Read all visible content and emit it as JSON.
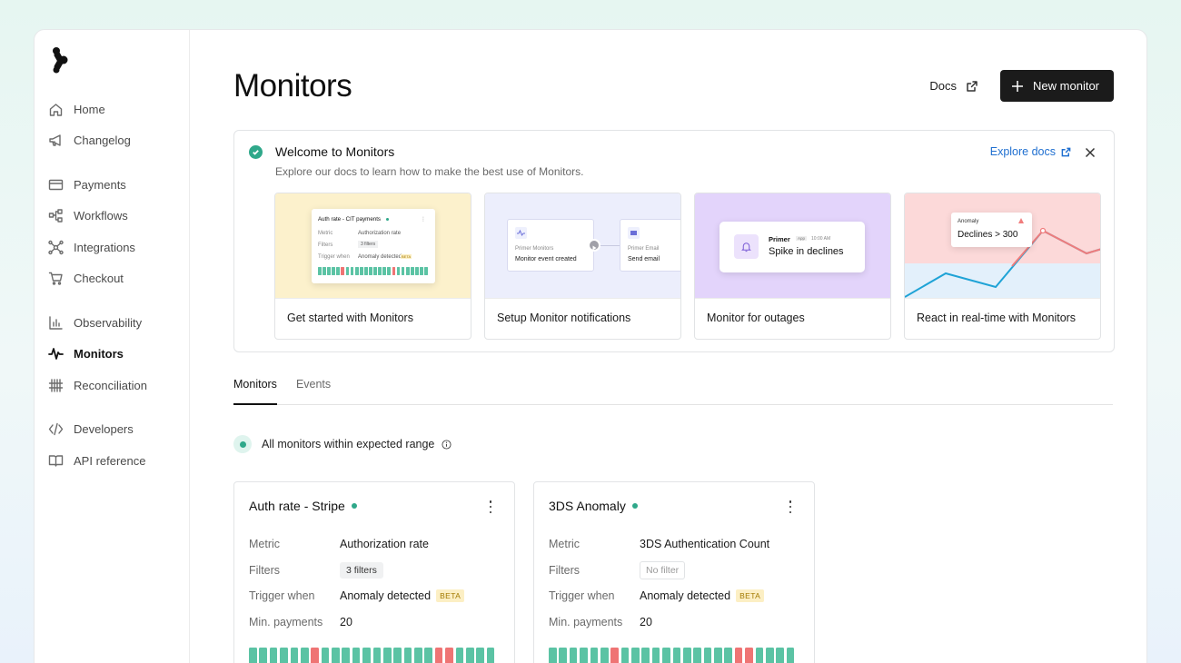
{
  "sidebar": {
    "groups": [
      [
        {
          "label": "Home",
          "icon": "home-icon"
        },
        {
          "label": "Changelog",
          "icon": "megaphone-icon"
        }
      ],
      [
        {
          "label": "Payments",
          "icon": "credit-card-icon"
        },
        {
          "label": "Workflows",
          "icon": "workflow-icon"
        },
        {
          "label": "Integrations",
          "icon": "integrations-icon"
        },
        {
          "label": "Checkout",
          "icon": "cart-icon"
        }
      ],
      [
        {
          "label": "Observability",
          "icon": "bar-chart-icon"
        },
        {
          "label": "Monitors",
          "icon": "pulse-icon",
          "active": true
        },
        {
          "label": "Reconciliation",
          "icon": "reconciliation-icon"
        }
      ],
      [
        {
          "label": "Developers",
          "icon": "code-icon"
        },
        {
          "label": "API reference",
          "icon": "book-icon"
        }
      ]
    ]
  },
  "header": {
    "title": "Monitors",
    "docs_label": "Docs",
    "new_monitor_label": "New monitor"
  },
  "welcome": {
    "title": "Welcome to Monitors",
    "subtitle": "Explore our docs to learn how to make the best use of Monitors.",
    "explore_label": "Explore docs",
    "cards": [
      {
        "label": "Get started with Monitors",
        "bg": "#fcf1cc",
        "mini": {
          "title": "Auth rate - CIT payments",
          "metric_k": "Metric",
          "metric_v": "Authorization rate",
          "filters_k": "Filters",
          "filters_v": "3 filters",
          "trigger_k": "Trigger when",
          "trigger_v": "Anomaly detected",
          "beta": "BETA"
        }
      },
      {
        "label": "Setup Monitor notifications",
        "bg": "#eceefc",
        "mini": {
          "a_small": "Primer Monitors",
          "a_big": "Monitor event created",
          "b_small": "Primer Email",
          "b_big": "Send email"
        }
      },
      {
        "label": "Monitor for outages",
        "bg": "#e3d4fb",
        "mini": {
          "brand": "Primer",
          "app": "App",
          "time": "10:00 AM",
          "message": "Spike in declines"
        }
      },
      {
        "label": "React in real-time with Monitors",
        "bg": "#fcd9d9",
        "mini": {
          "tag": "Anomaly",
          "text": "Declines > 300"
        }
      }
    ]
  },
  "tabs": [
    {
      "label": "Monitors",
      "active": true
    },
    {
      "label": "Events",
      "active": false
    }
  ],
  "status": {
    "text": "All monitors within expected range"
  },
  "monitors": [
    {
      "name": "Auth rate - Stripe",
      "rows": [
        {
          "key": "Metric",
          "value": "Authorization rate"
        },
        {
          "key": "Filters",
          "value": "3 filters",
          "kind": "pill"
        },
        {
          "key": "Trigger when",
          "value": "Anomaly detected",
          "badge": "BETA"
        },
        {
          "key": "Min. payments",
          "value": "20"
        }
      ],
      "bars": [
        "ok",
        "ok",
        "ok",
        "ok",
        "ok",
        "ok",
        "bad",
        "ok",
        "ok",
        "ok",
        "ok",
        "ok",
        "ok",
        "ok",
        "ok",
        "ok",
        "ok",
        "ok",
        "bad",
        "bad",
        "ok",
        "ok",
        "ok",
        "ok"
      ]
    },
    {
      "name": "3DS Anomaly",
      "rows": [
        {
          "key": "Metric",
          "value": "3DS Authentication Count"
        },
        {
          "key": "Filters",
          "value": "No filter",
          "kind": "outline"
        },
        {
          "key": "Trigger when",
          "value": "Anomaly detected",
          "badge": "BETA"
        },
        {
          "key": "Min. payments",
          "value": "20"
        }
      ],
      "bars": [
        "ok",
        "ok",
        "ok",
        "ok",
        "ok",
        "ok",
        "bad",
        "ok",
        "ok",
        "ok",
        "ok",
        "ok",
        "ok",
        "ok",
        "ok",
        "ok",
        "ok",
        "ok",
        "bad",
        "bad",
        "ok",
        "ok",
        "ok",
        "ok"
      ]
    }
  ]
}
